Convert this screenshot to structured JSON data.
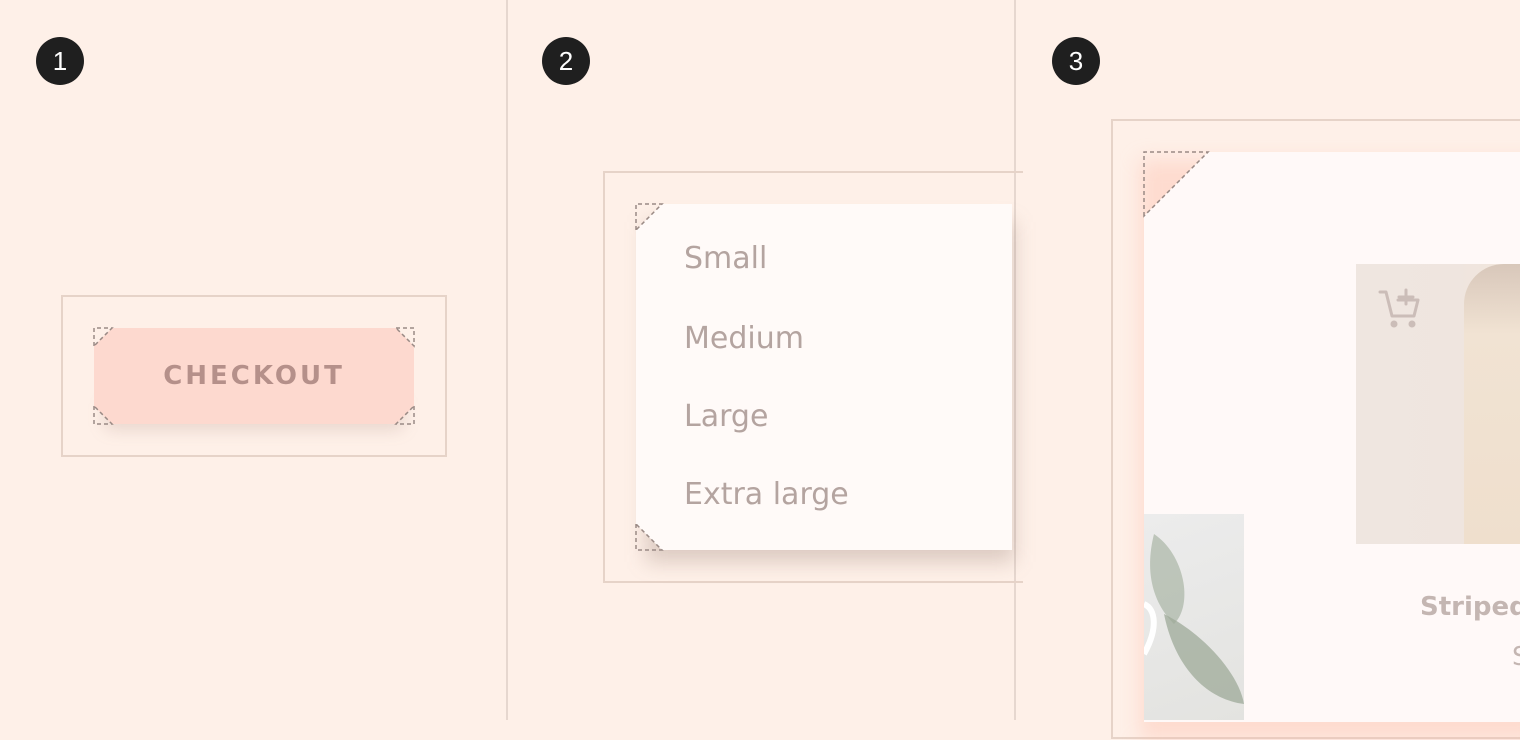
{
  "badges": [
    "1",
    "2",
    "3"
  ],
  "checkout": {
    "label": "CHECKOUT"
  },
  "size_menu": {
    "items": [
      "Small",
      "Medium",
      "Large",
      "Extra large"
    ]
  },
  "product_card": {
    "title": "Striped",
    "price": "S",
    "cart_icon": "add-to-cart-icon"
  },
  "colors": {
    "background": "#fef0e8",
    "button_fill": "#fdd9cf",
    "button_text": "#b5908a",
    "surface": "#fffaf8",
    "menu_text": "#b4a4a0",
    "badge": "#1f1f1f"
  }
}
